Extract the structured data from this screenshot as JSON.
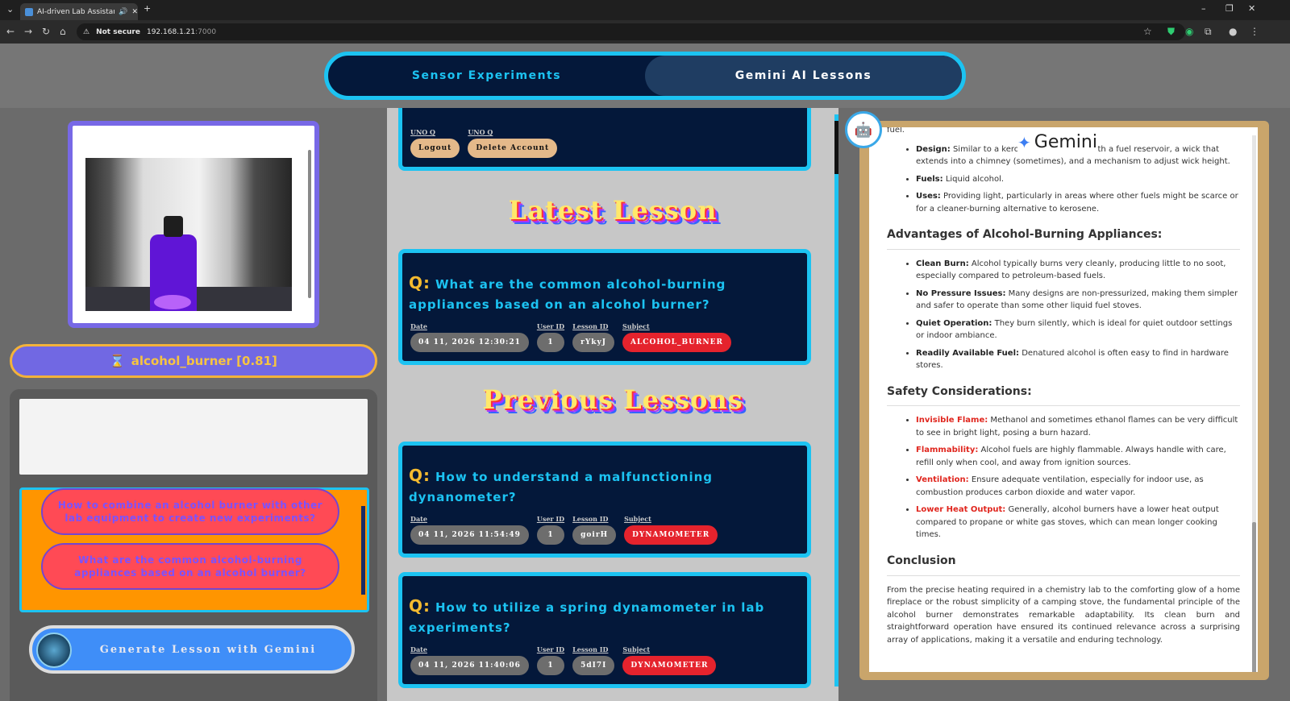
{
  "browser": {
    "tab_title": "AI-driven Lab Assistant",
    "audio_icon": "speaker-icon",
    "not_secure": "Not secure",
    "url_host": "192.168.1.21",
    "url_port": ":7000"
  },
  "header": {
    "tab1": "Sensor Experiments",
    "tab2": "Gemini AI Lessons"
  },
  "left": {
    "prediction": "alcohol_burner [0.81]",
    "hourglass": "⌛",
    "suggestion1": "How to combine an alcohol burner with other lab equipment to create new experiments?",
    "suggestion2": "What are the common alcohol-burning appliances based on an alcohol burner?",
    "generate_button": "Generate Lesson with Gemini"
  },
  "account": {
    "label1": "UNO Q",
    "label2": "UNO Q",
    "logout": "Logout",
    "delete": "Delete Account"
  },
  "latest_title": "Latest Lesson",
  "previous_title": "Previous Lessons",
  "meta_labels": {
    "date": "Date",
    "user": "User ID",
    "lesson": "Lesson ID",
    "subject": "Subject"
  },
  "lessons": [
    {
      "q": "What are the common alcohol-burning appliances based on an alcohol burner?",
      "date": "04 11, 2026 12:30:21",
      "user": "1",
      "lesson": "rYkyJ",
      "subject": "ALCOHOL_BURNER"
    },
    {
      "q": "How to understand a malfunctioning dynanometer?",
      "date": "04 11, 2026 11:54:49",
      "user": "1",
      "lesson": "goirH",
      "subject": "DYNAMOMETER"
    },
    {
      "q": "How to utilize a spring dynamometer in lab experiments?",
      "date": "04 11, 2026 11:40:06",
      "user": "1",
      "lesson": "5dI7I",
      "subject": "DYNAMOMETER"
    }
  ],
  "gemini": {
    "logo": "Gemini",
    "fuel_line": "fuel.",
    "lamp": [
      {
        "k": "Design:",
        "v": "Similar to a kerosene or oil lamp, with a fuel reservoir, a wick that extends into a chimney (sometimes), and a mechanism to adjust wick height."
      },
      {
        "k": "Fuels:",
        "v": "Liquid alcohol."
      },
      {
        "k": "Uses:",
        "v": "Providing light, particularly in areas where other fuels might be scarce or for a cleaner-burning alternative to kerosene."
      }
    ],
    "adv_title": "Advantages of Alcohol-Burning Appliances:",
    "advantages": [
      {
        "k": "Clean Burn:",
        "v": "Alcohol typically burns very cleanly, producing little to no soot, especially compared to petroleum-based fuels."
      },
      {
        "k": "No Pressure Issues:",
        "v": "Many designs are non-pressurized, making them simpler and safer to operate than some other liquid fuel stoves."
      },
      {
        "k": "Quiet Operation:",
        "v": "They burn silently, which is ideal for quiet outdoor settings or indoor ambiance."
      },
      {
        "k": "Readily Available Fuel:",
        "v": "Denatured alcohol is often easy to find in hardware stores."
      }
    ],
    "safety_title": "Safety Considerations:",
    "safety": [
      {
        "k": "Invisible Flame:",
        "v": "Methanol and sometimes ethanol flames can be very difficult to see in bright light, posing a burn hazard."
      },
      {
        "k": "Flammability:",
        "v": "Alcohol fuels are highly flammable. Always handle with care, refill only when cool, and away from ignition sources."
      },
      {
        "k": "Ventilation:",
        "v": "Ensure adequate ventilation, especially for indoor use, as combustion produces carbon dioxide and water vapor."
      },
      {
        "k": "Lower Heat Output:",
        "v": "Generally, alcohol burners have a lower heat output compared to propane or white gas stoves, which can mean longer cooking times."
      }
    ],
    "conclusion_title": "Conclusion",
    "conclusion": "From the precise heating required in a chemistry lab to the comforting glow of a home fireplace or the robust simplicity of a camping stove, the fundamental principle of the alcohol burner demonstrates remarkable adaptability. Its clean burn and straightforward operation have ensured its continued relevance across a surprising array of applications, making it a versatile and enduring technology."
  }
}
